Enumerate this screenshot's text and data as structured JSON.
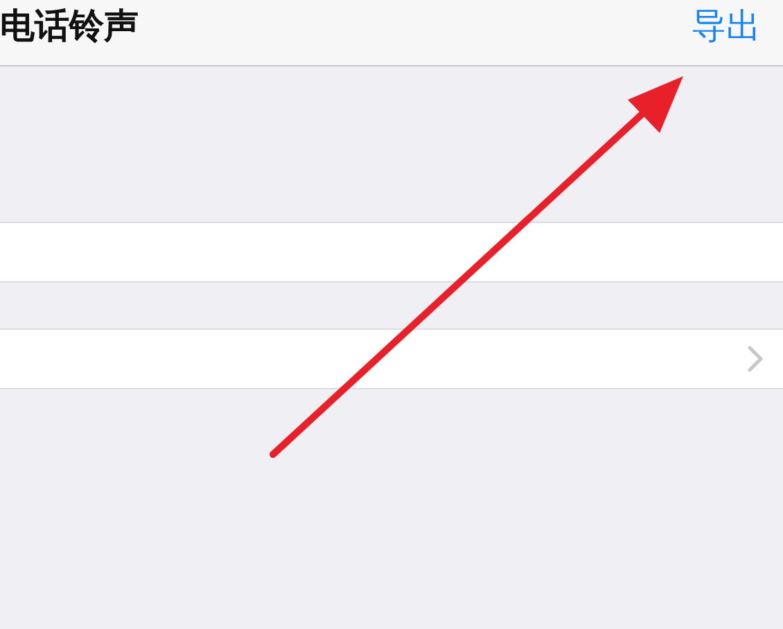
{
  "nav_bar": {
    "title": "电话铃声",
    "action": "导出"
  },
  "rows": [
    {
      "kind": "plain"
    },
    {
      "kind": "disclosure"
    }
  ],
  "annotation": {
    "kind": "arrow"
  }
}
